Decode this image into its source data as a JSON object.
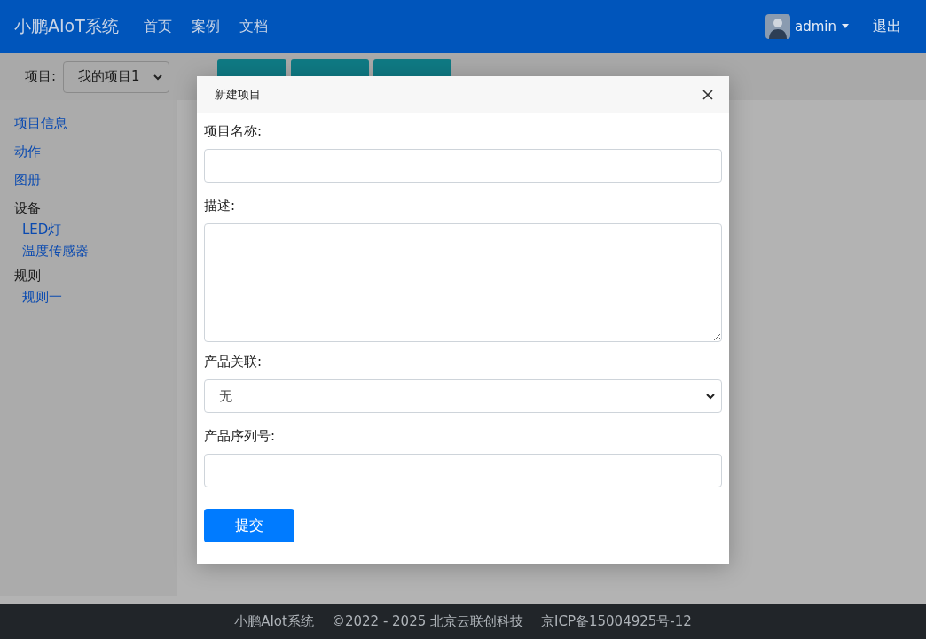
{
  "navbar": {
    "brand": "小鹏AIoT系统",
    "links": [
      "首页",
      "案例",
      "文档"
    ],
    "user": "admin",
    "logout": "退出"
  },
  "toolbar": {
    "project_label": "项目:",
    "project_value": "我的项目1"
  },
  "sidebar": {
    "items": [
      {
        "label": "项目信息",
        "kind": "link"
      },
      {
        "label": "动作",
        "kind": "link"
      },
      {
        "label": "图册",
        "kind": "link"
      },
      {
        "label": "设备",
        "kind": "heading",
        "children": [
          {
            "label": "LED灯"
          },
          {
            "label": "温度传感器"
          }
        ]
      },
      {
        "label": "规则",
        "kind": "heading",
        "children": [
          {
            "label": "规则一"
          }
        ]
      }
    ]
  },
  "modal": {
    "title": "新建项目",
    "fields": [
      {
        "label": "项目名称:",
        "kind": "input"
      },
      {
        "label": "描述:",
        "kind": "textarea"
      },
      {
        "label": "产品关联:",
        "kind": "select",
        "value": "无"
      },
      {
        "label": "产品序列号:",
        "kind": "input"
      }
    ],
    "submit": "提交"
  },
  "footer": {
    "parts": [
      "小鹏AIot系统",
      "©2022 - 2025 北京云联创科技",
      "京ICP备15004925号-12"
    ]
  }
}
